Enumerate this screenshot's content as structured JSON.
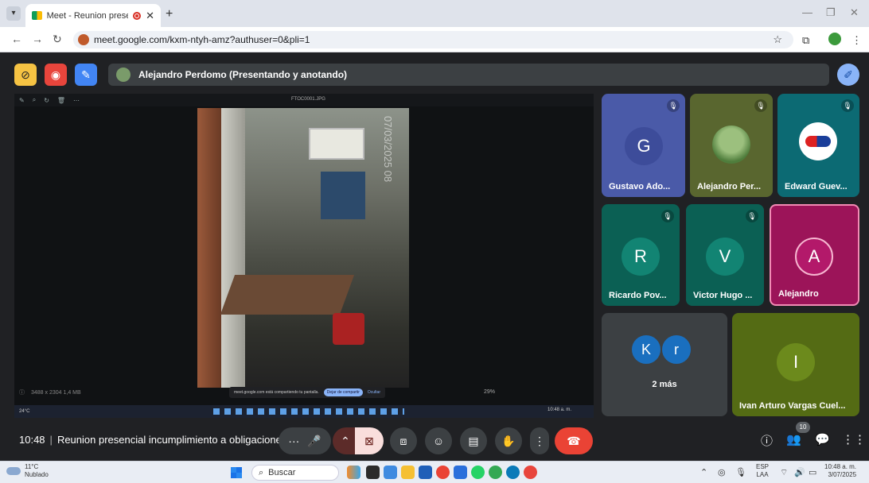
{
  "browser": {
    "tab_title": "Meet - Reunion presencial i",
    "tab_close": "✕",
    "new_tab": "+",
    "url": "meet.google.com/kxm-ntyh-amz?authuser=0&pli=1"
  },
  "presenter": {
    "label": "Alejandro Perdomo (Presentando y anotando)"
  },
  "shared_screen": {
    "window_title": "FTOC0001.JPG",
    "photo_timestamp": "07/03/2025 08",
    "bottom_info": "3488 x 2304   1,4 MB",
    "notice_text": "meet.google.com está compartiendo tu pantalla.",
    "notice_button": "Dejar de compartir",
    "notice_hide": "Ocultar",
    "zoom": "29%",
    "taskbar_weather": "24°C",
    "taskbar_clock": "10:48 a. m."
  },
  "participants": [
    {
      "name": "Gustavo Ado...",
      "initial": "G",
      "color": "#4a5aa8",
      "avatar_color": "#3d4c9a",
      "muted": true
    },
    {
      "name": "Alejandro Per...",
      "initial": "",
      "color": "#59662f",
      "muted": true
    },
    {
      "name": "Edward Guev...",
      "initial": "",
      "color": "#0c6a73",
      "muted": true
    },
    {
      "name": "Ricardo Pov...",
      "initial": "R",
      "color": "#0b6054",
      "avatar_color": "#128473",
      "muted": true
    },
    {
      "name": "Victor Hugo ...",
      "initial": "V",
      "color": "#0b6054",
      "avatar_color": "#128473",
      "muted": true
    },
    {
      "name": "Alejandro",
      "initial": "A",
      "color": "#9c1459",
      "avatar_color": "#b3196a",
      "muted": false
    }
  ],
  "more_tile": {
    "initials": [
      "K",
      "r"
    ],
    "label": "2 más"
  },
  "pinned_tile": {
    "name": "Ivan Arturo Vargas Cuel...",
    "initial": "I",
    "color": "#546b14",
    "avatar_color": "#6c8a1c"
  },
  "meeting": {
    "time": "10:48",
    "separator": "|",
    "title": "Reunion presencial incumplimiento a obligacione..."
  },
  "people_count": "10",
  "windows": {
    "weather_temp": "11°C",
    "weather_desc": "Nublado",
    "search_label": "Buscar",
    "lang_top": "ESP",
    "lang_bottom": "LAA",
    "time": "10:48 a. m.",
    "date": "3/07/2025"
  }
}
